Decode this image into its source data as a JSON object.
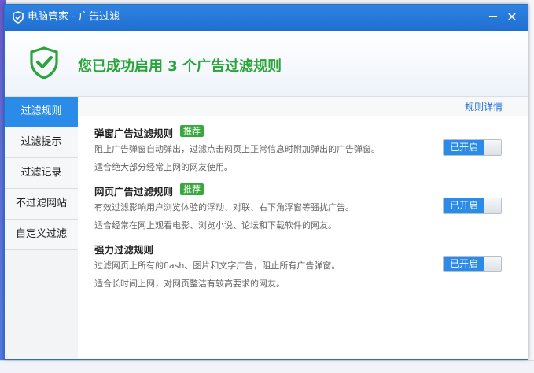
{
  "window": {
    "title": "电脑管家 - 广告过滤",
    "minimize": "－",
    "close": "✕"
  },
  "header": {
    "headline": "您已成功启用 3 个广告过滤规则",
    "icon": "shield-check-icon"
  },
  "sidebar": {
    "items": [
      {
        "label": "过滤规则",
        "active": true
      },
      {
        "label": "过滤提示",
        "active": false
      },
      {
        "label": "过滤记录",
        "active": false
      },
      {
        "label": "不过滤网站",
        "active": false
      },
      {
        "label": "自定义过滤",
        "active": false
      }
    ]
  },
  "content": {
    "details_link": "规则详情",
    "rules": [
      {
        "title": "弹窗广告过滤规则",
        "badge": "推荐",
        "desc1": "阻止广告弹窗自动弹出，过滤点击网页上正常信息时附加弹出的广告弹窗。",
        "desc2": "适合绝大部分经常上网的网友使用。",
        "toggle": "已开启"
      },
      {
        "title": "网页广告过滤规则",
        "badge": "推荐",
        "desc1": "有效过滤影响用户浏览体验的浮动、对联、右下角浮窗等骚扰广告。",
        "desc2": "适合经常在网上观看电影、浏览小说、论坛和下载软件的网友。",
        "toggle": "已开启"
      },
      {
        "title": "强力过滤规则",
        "badge": "",
        "desc1": "过滤网页上所有的flash、图片和文字广告，阻止所有广告弹窗。",
        "desc2": "适合长时间上网，对网页整洁有较高要求的网友。",
        "toggle": "已开启"
      }
    ]
  },
  "colors": {
    "accent": "#2b8be8",
    "success": "#29a33a",
    "badge": "#38a83d",
    "titlebar": "#2277d8"
  }
}
